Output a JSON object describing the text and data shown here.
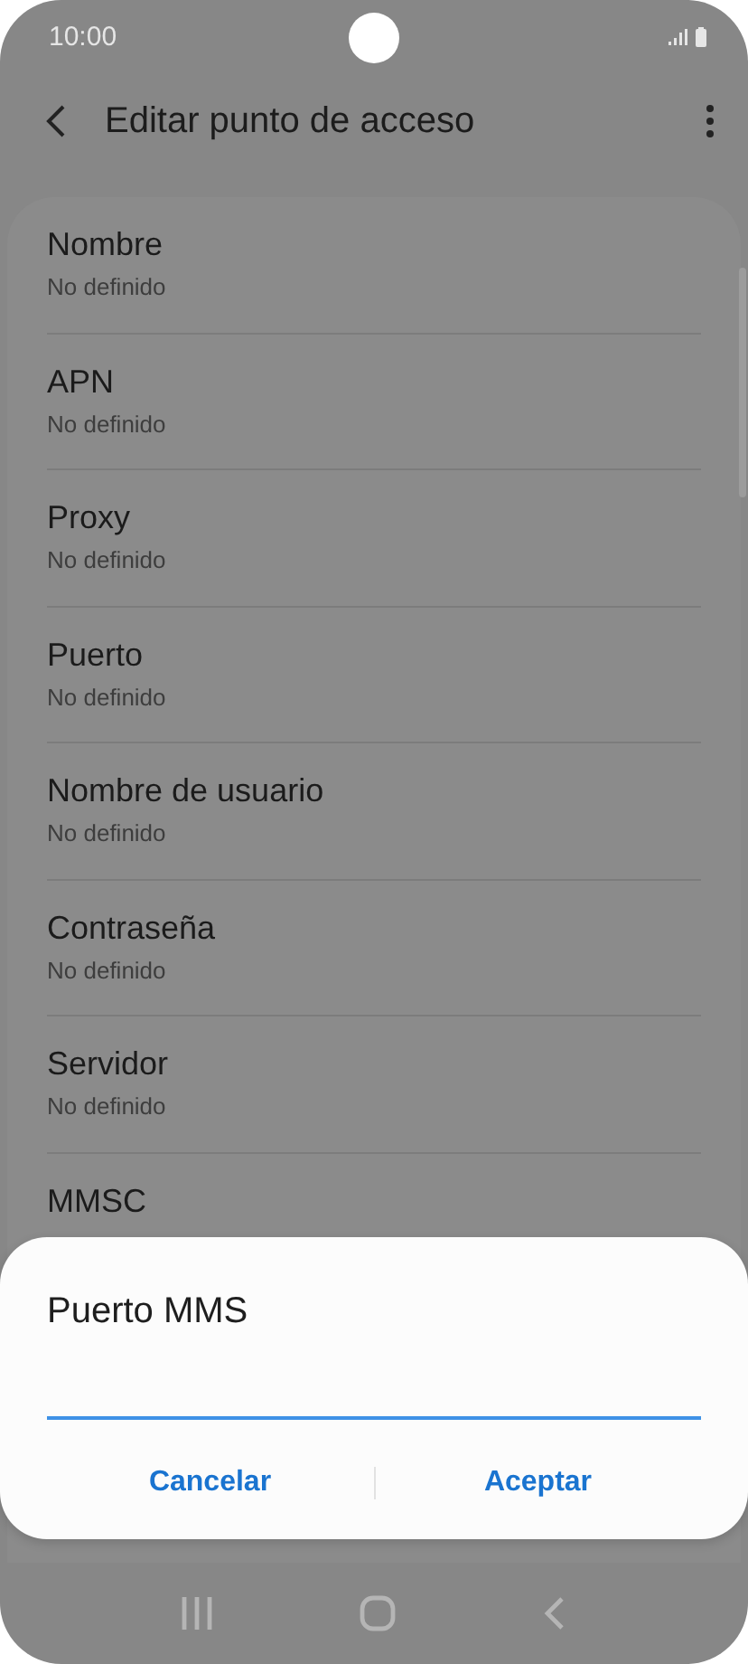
{
  "status_bar": {
    "time": "10:00"
  },
  "header": {
    "title": "Editar punto de acceso"
  },
  "settings": [
    {
      "title": "Nombre",
      "value": "No definido"
    },
    {
      "title": "APN",
      "value": "No definido"
    },
    {
      "title": "Proxy",
      "value": "No definido"
    },
    {
      "title": "Puerto",
      "value": "No definido"
    },
    {
      "title": "Nombre de usuario",
      "value": "No definido"
    },
    {
      "title": "Contraseña",
      "value": "No definido"
    },
    {
      "title": "Servidor",
      "value": "No definido"
    },
    {
      "title": "MMSC"
    }
  ],
  "dialog": {
    "title": "Puerto MMS",
    "input": {
      "focused": true
    },
    "buttons": [
      "Cancelar",
      "Aceptar"
    ]
  }
}
